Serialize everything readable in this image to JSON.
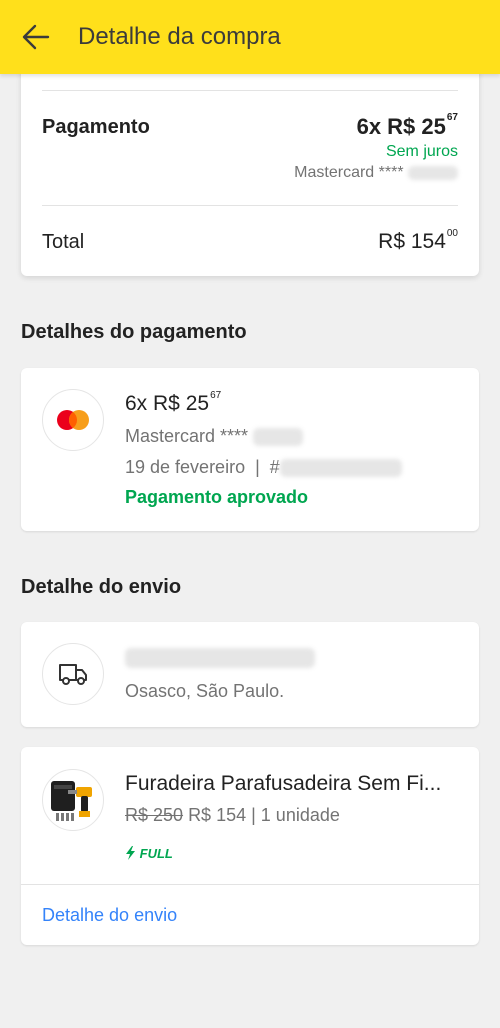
{
  "header": {
    "title": "Detalhe da compra",
    "bg_color": "#ffe01b"
  },
  "summary": {
    "payment_label": "Pagamento",
    "installment_prefix": "6x R$ 25",
    "installment_cents": "67",
    "interest_label": "Sem juros",
    "card_label": "Mastercard ****",
    "total_label": "Total",
    "total_value": "R$ 154",
    "total_cents": "00"
  },
  "payment_details": {
    "section_title": "Detalhes do pagamento",
    "icon": "mastercard-icon",
    "installment_prefix": "6x R$ 25",
    "installment_cents": "67",
    "card_label": "Mastercard ****",
    "date_label": "19 de fevereiro  |  #",
    "status": "Pagamento aprovado",
    "status_color": "#00a650"
  },
  "shipping": {
    "section_title": "Detalhe do envio",
    "icon": "truck-icon",
    "city": "Osasco, São Paulo."
  },
  "product": {
    "title": "Furadeira Parafusadeira Sem Fi...",
    "old_price": "R$ 250",
    "price": "R$ 154",
    "quantity": "1 unidade",
    "badge": "FULL",
    "badge_color": "#00a650",
    "link_label": "Detalhe do envio",
    "link_color": "#3483fa"
  }
}
